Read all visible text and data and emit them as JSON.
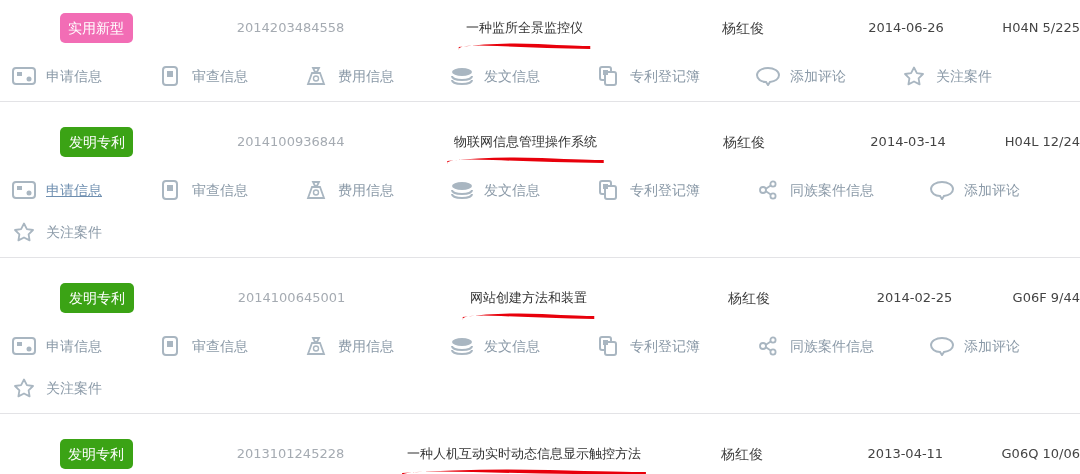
{
  "records": [
    {
      "tag": {
        "text": "实用新型",
        "color": "#f26db5"
      },
      "number": "2014203484558",
      "title": "一种监所全景监控仪",
      "inventor": "杨红俊",
      "date": "2014-06-26",
      "classification": "H04N 5/225",
      "actions": [
        {
          "kind": "application",
          "label": "申请信息",
          "hovered": false
        },
        {
          "kind": "review",
          "label": "审查信息",
          "hovered": false
        },
        {
          "kind": "fee",
          "label": "费用信息",
          "hovered": false
        },
        {
          "kind": "dispatch",
          "label": "发文信息",
          "hovered": false
        },
        {
          "kind": "register",
          "label": "专利登记簿",
          "hovered": false
        },
        {
          "kind": "comment",
          "label": "添加评论",
          "hovered": false
        },
        {
          "kind": "follow",
          "label": "关注案件",
          "hovered": false
        }
      ]
    },
    {
      "tag": {
        "text": "发明专利",
        "color": "#3ba315"
      },
      "number": "2014100936844",
      "title": "物联网信息管理操作系统",
      "inventor": "杨红俊",
      "date": "2014-03-14",
      "classification": "H04L 12/24",
      "actions": [
        {
          "kind": "application",
          "label": "申请信息",
          "hovered": true
        },
        {
          "kind": "review",
          "label": "审查信息",
          "hovered": false
        },
        {
          "kind": "fee",
          "label": "费用信息",
          "hovered": false
        },
        {
          "kind": "dispatch",
          "label": "发文信息",
          "hovered": false
        },
        {
          "kind": "register",
          "label": "专利登记簿",
          "hovered": false
        },
        {
          "kind": "family",
          "label": "同族案件信息",
          "hovered": false
        },
        {
          "kind": "comment",
          "label": "添加评论",
          "hovered": false
        },
        {
          "kind": "follow",
          "label": "关注案件",
          "hovered": false
        }
      ]
    },
    {
      "tag": {
        "text": "发明专利",
        "color": "#3ba315"
      },
      "number": "2014100645001",
      "title": "网站创建方法和装置",
      "inventor": "杨红俊",
      "date": "2014-02-25",
      "classification": "G06F 9/44",
      "actions": [
        {
          "kind": "application",
          "label": "申请信息",
          "hovered": false
        },
        {
          "kind": "review",
          "label": "审查信息",
          "hovered": false
        },
        {
          "kind": "fee",
          "label": "费用信息",
          "hovered": false
        },
        {
          "kind": "dispatch",
          "label": "发文信息",
          "hovered": false
        },
        {
          "kind": "register",
          "label": "专利登记簿",
          "hovered": false
        },
        {
          "kind": "family",
          "label": "同族案件信息",
          "hovered": false
        },
        {
          "kind": "comment",
          "label": "添加评论",
          "hovered": false
        },
        {
          "kind": "follow",
          "label": "关注案件",
          "hovered": false
        }
      ]
    },
    {
      "tag": {
        "text": "发明专利",
        "color": "#3ba315"
      },
      "number": "2013101245228",
      "title": "一种人机互动实时动态信息显示触控方法",
      "inventor": "杨红俊",
      "date": "2013-04-11",
      "classification": "G06Q 10/06"
    }
  ]
}
